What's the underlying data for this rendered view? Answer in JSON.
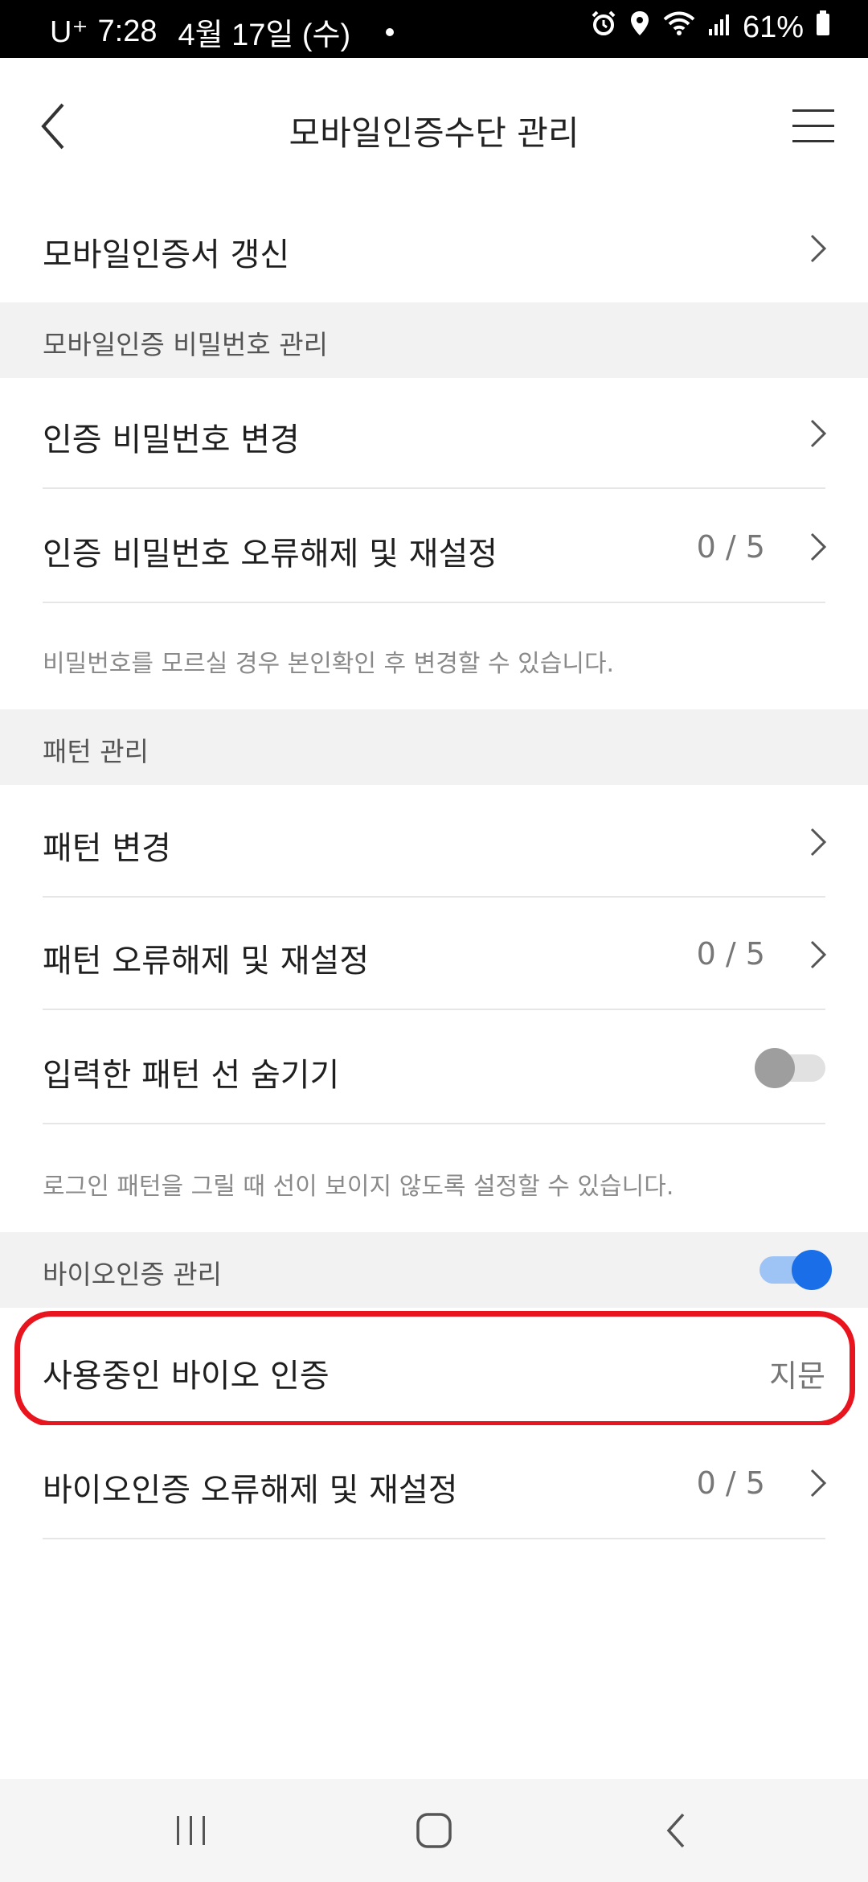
{
  "status_bar": {
    "carrier": "U⁺",
    "time": "7:28",
    "date": "4월 17일 (수)",
    "battery": "61%",
    "icons": [
      "alarm-icon",
      "location-icon",
      "wifi-icon",
      "signal-icon",
      "battery-icon"
    ]
  },
  "header": {
    "title": "모바일인증수단 관리",
    "back_icon": "chevron-left-icon",
    "menu_icon": "hamburger-menu-icon"
  },
  "items": {
    "renew_cert": "모바일인증서 갱신",
    "section_password": "모바일인증 비밀번호 관리",
    "change_password": "인증 비밀번호 변경",
    "reset_password": "인증 비밀번호 오류해제 및 재설정",
    "reset_password_count": "0 / 5",
    "password_note": "비밀번호를 모르실 경우 본인확인 후 변경할 수 있습니다.",
    "section_pattern": "패턴 관리",
    "change_pattern": "패턴 변경",
    "reset_pattern": "패턴 오류해제 및 재설정",
    "reset_pattern_count": "0 / 5",
    "hide_pattern_line": "입력한 패턴 선 숨기기",
    "hide_pattern_line_on": false,
    "pattern_note": "로그인 패턴을 그릴 때 선이 보이지 않도록 설정할 수 있습니다.",
    "section_bio": "바이오인증 관리",
    "bio_enabled": true,
    "bio_in_use": "사용중인 바이오 인증",
    "bio_in_use_value": "지문",
    "reset_bio": "바이오인증 오류해제 및 재설정",
    "reset_bio_count": "0 / 5"
  },
  "colors": {
    "accent": "#1a6fe8",
    "highlight": "#e8141e",
    "section_bg": "#f2f2f2"
  }
}
